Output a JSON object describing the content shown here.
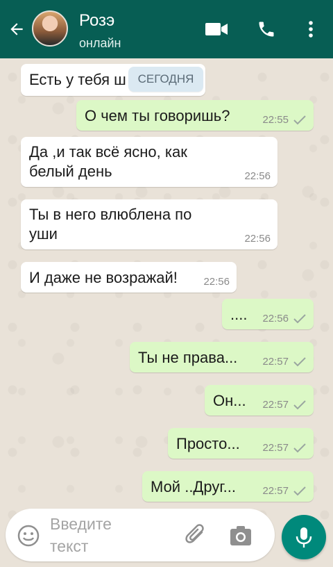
{
  "header": {
    "contact_name": "Розэ",
    "status": "онлайн"
  },
  "date_divider": "СЕГОДНЯ",
  "messages": [
    {
      "direction": "in",
      "text": "Есть у тебя ш",
      "time": ""
    },
    {
      "direction": "out",
      "text": "О чем ты говоришь?",
      "time": "22:55"
    },
    {
      "direction": "in",
      "text_line1": "Да ,и так всё ясно, как",
      "text_line2": "белый день",
      "time": "22:56"
    },
    {
      "direction": "in",
      "text_line1": "Ты в него влюблена по",
      "text_line2": "уши",
      "time": "22:56"
    },
    {
      "direction": "in",
      "text": "И даже не возражай!",
      "time": "22:56"
    },
    {
      "direction": "out",
      "text": "....",
      "time": "22:56"
    },
    {
      "direction": "out",
      "text": "Ты не права...",
      "time": "22:57"
    },
    {
      "direction": "out",
      "text": "Он...",
      "time": "22:57"
    },
    {
      "direction": "out",
      "text": "Просто...",
      "time": "22:57"
    },
    {
      "direction": "out",
      "text": "Мой ..Друг...",
      "time": "22:57"
    }
  ],
  "composer": {
    "placeholder": "Введите текст"
  },
  "colors": {
    "header": "#075e54",
    "outgoing_bubble": "#dcf8c6",
    "incoming_bubble": "#ffffff",
    "mic_button": "#00897b"
  },
  "icons": [
    "back-arrow-icon",
    "video-call-icon",
    "phone-icon",
    "more-vert-icon",
    "tick-icon",
    "emoji-icon",
    "attach-icon",
    "camera-icon",
    "mic-icon"
  ]
}
